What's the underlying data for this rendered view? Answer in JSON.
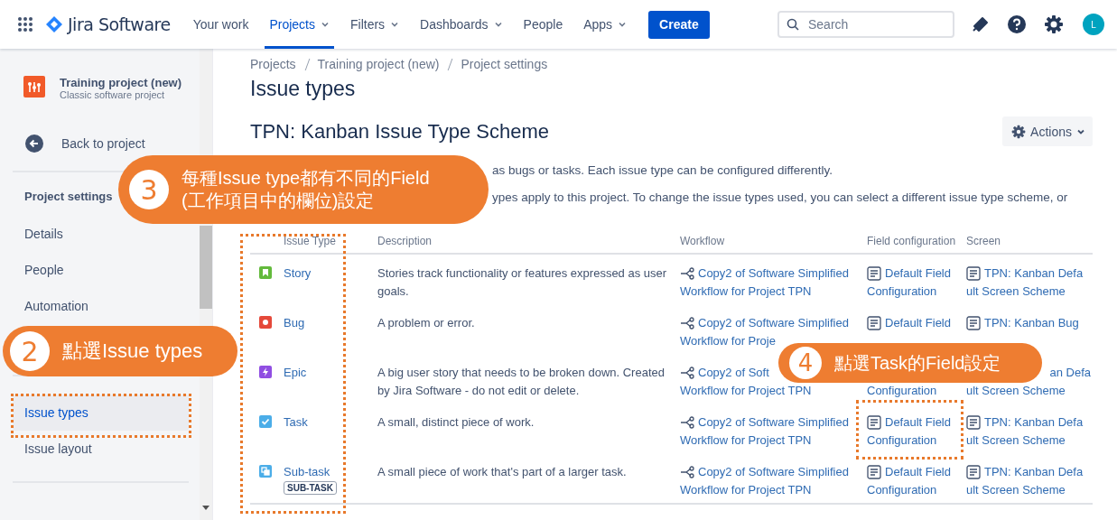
{
  "top_nav": {
    "product": "Jira Software",
    "items": [
      {
        "label": "Your work",
        "selected": false,
        "dropdown": false
      },
      {
        "label": "Projects",
        "selected": true,
        "dropdown": true
      },
      {
        "label": "Filters",
        "selected": false,
        "dropdown": true
      },
      {
        "label": "Dashboards",
        "selected": false,
        "dropdown": true
      },
      {
        "label": "People",
        "selected": false,
        "dropdown": false
      },
      {
        "label": "Apps",
        "selected": false,
        "dropdown": true
      }
    ],
    "create": "Create",
    "search": {
      "placeholder": "Search"
    },
    "avatar": "L"
  },
  "sidebar": {
    "project": {
      "name": "Training project (new)",
      "type": "Classic software project"
    },
    "back": "Back to project",
    "heading": "Project settings",
    "groups": [
      {
        "items": [
          {
            "label": "Details",
            "selected": false
          },
          {
            "label": "People",
            "selected": false
          },
          {
            "label": "Automation",
            "selected": false
          }
        ]
      },
      {
        "items": [
          {
            "label": "Issue types",
            "selected": true
          },
          {
            "label": "Issue layout",
            "selected": false
          }
        ]
      }
    ]
  },
  "breadcrumbs": [
    "Projects",
    "Training project (new)",
    "Project settings"
  ],
  "title": "Issue types",
  "scheme": {
    "title": "TPN: Kanban Issue Type Scheme",
    "actions": "Actions"
  },
  "intro": [
    "as bugs or tasks. Each issue type can be configured differently.",
    "ypes apply to this project. To change the issue types used, you can select a different issue type scheme, or"
  ],
  "table": {
    "columns": [
      "Issue Type",
      "Description",
      "Workflow",
      "Field configuration",
      "Screen"
    ],
    "rows": [
      {
        "kind": "story",
        "color": "#63ba3c",
        "name": "Story",
        "description": "Stories track functionality or features expressed as user goals.",
        "workflow": {
          "lines": [
            "Copy2 of Software Simplified",
            "Workflow for Project TPN"
          ]
        },
        "field_configuration": {
          "lines": [
            "Default Field",
            "Configuration"
          ]
        },
        "screen": {
          "lines": [
            "TPN: Kanban Defa",
            "ult Screen Scheme"
          ]
        }
      },
      {
        "kind": "bug",
        "color": "#e5493a",
        "name": "Bug",
        "description": "A problem or error.",
        "workflow": {
          "lines": [
            "Copy2 of Software Simplified",
            "Workflow for Proje"
          ]
        },
        "field_configuration": {
          "lines": [
            "Default Field"
          ]
        },
        "screen": {
          "lines": [
            "TPN: Kanban Bug"
          ]
        }
      },
      {
        "kind": "epic",
        "color": "#904ee2",
        "name": "Epic",
        "description": "A big user story that needs to be broken down. Created by Jira Software - do not edit or delete.",
        "workflow": {
          "lines": [
            "Copy2 of Soft",
            "Workflow for Project TPN"
          ]
        },
        "field_configuration": {
          "first_line_hidden": true,
          "lines": [
            "Configuration"
          ]
        },
        "screen": {
          "first_line_cut": true,
          "lines": [
            "an Defa",
            "ult Screen Scheme"
          ]
        }
      },
      {
        "kind": "task",
        "color": "#4bade8",
        "name": "Task",
        "description": "A small, distinct piece of work.",
        "workflow": {
          "lines": [
            "Copy2 of Software Simplified",
            "Workflow for Project TPN"
          ]
        },
        "field_configuration": {
          "lines": [
            "Default Field",
            "Configuration"
          ]
        },
        "screen": {
          "lines": [
            "TPN: Kanban Defa",
            "ult Screen Scheme"
          ]
        }
      },
      {
        "kind": "subtask",
        "color": "#4bade8",
        "name": "Sub-task",
        "badge": "SUB-TASK",
        "description": "A small piece of work that's part of a larger task.",
        "workflow": {
          "lines": [
            "Copy2 of Software Simplified",
            "Workflow for Project TPN"
          ]
        },
        "field_configuration": {
          "lines": [
            "Default Field",
            "Configuration"
          ]
        },
        "screen": {
          "lines": [
            "TPN: Kanban Defa",
            "ult Screen Scheme"
          ]
        }
      }
    ]
  },
  "callouts": [
    {
      "number": "3",
      "text": "每種Issue type都有不同的Field\n(工作項目中的欄位)設定"
    },
    {
      "number": "2",
      "text": "點選Issue types"
    },
    {
      "number": "4",
      "text": "點選Task的Field設定"
    }
  ]
}
